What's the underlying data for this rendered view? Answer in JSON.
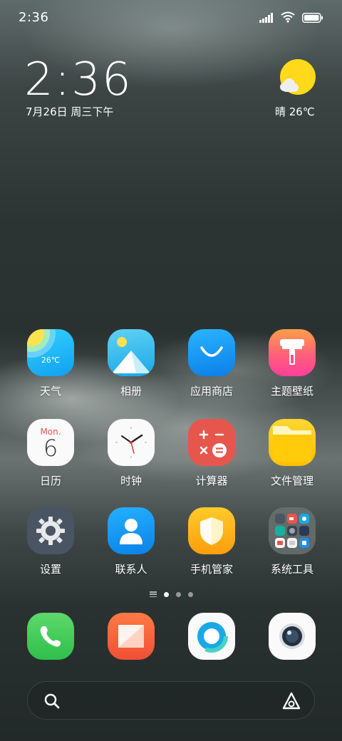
{
  "status_bar": {
    "time": "2:36",
    "icons": [
      "signal-icon",
      "wifi-icon",
      "battery-icon"
    ]
  },
  "widget": {
    "time": "2:36",
    "date": "7月26日 周三下午",
    "weather": "晴 26℃",
    "weather_icon": "sun-cloud-icon"
  },
  "apps": [
    {
      "label": "天气",
      "icon": "weather-icon",
      "temp": "26℃"
    },
    {
      "label": "相册",
      "icon": "gallery-icon"
    },
    {
      "label": "应用商店",
      "icon": "app-store-icon"
    },
    {
      "label": "主题壁纸",
      "icon": "themes-icon"
    },
    {
      "label": "日历",
      "icon": "calendar-icon",
      "weekday": "Mon.",
      "day": "6"
    },
    {
      "label": "时钟",
      "icon": "clock-icon"
    },
    {
      "label": "计算器",
      "icon": "calculator-icon"
    },
    {
      "label": "文件管理",
      "icon": "folder-icon"
    },
    {
      "label": "设置",
      "icon": "settings-icon"
    },
    {
      "label": "联系人",
      "icon": "contacts-icon"
    },
    {
      "label": "手机管家",
      "icon": "security-icon"
    },
    {
      "label": "系统工具",
      "icon": "folder-system-tools-icon"
    }
  ],
  "pages": {
    "count": 3,
    "current": 1
  },
  "dock": [
    {
      "name": "phone",
      "icon": "phone-icon"
    },
    {
      "name": "messages",
      "icon": "messages-icon"
    },
    {
      "name": "browser",
      "icon": "browser-icon"
    },
    {
      "name": "camera",
      "icon": "camera-icon"
    }
  ],
  "search": {
    "icon": "search-icon",
    "assistant_icon": "assistant-icon"
  },
  "colors": {
    "weather_sun": "#ffd91a",
    "text": "#ffffff"
  }
}
